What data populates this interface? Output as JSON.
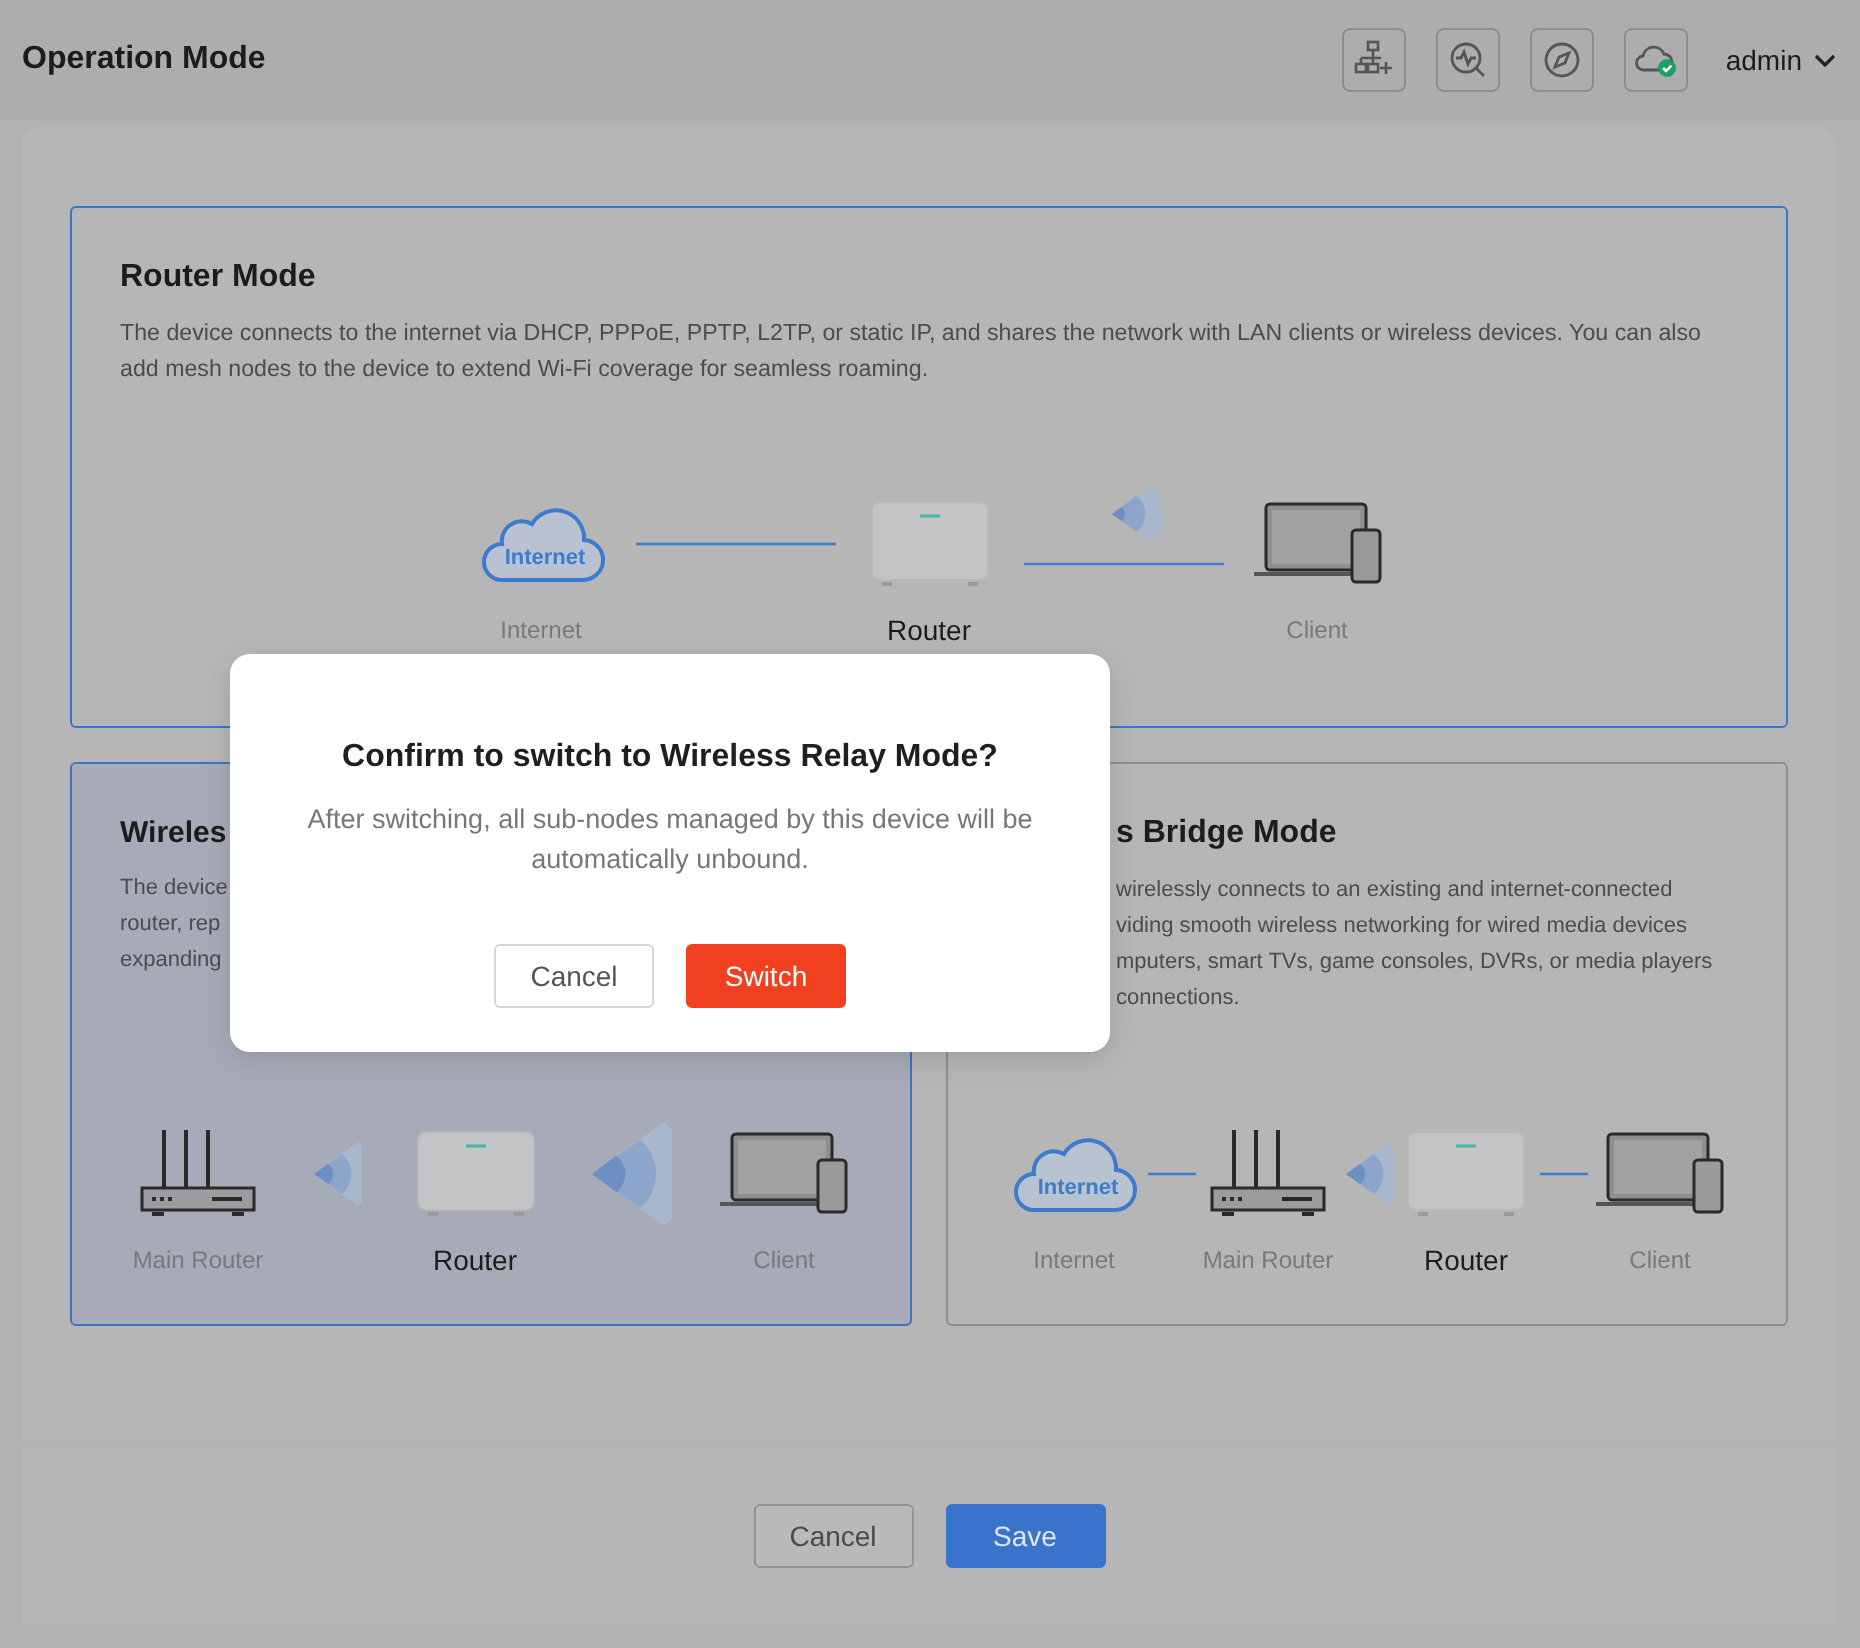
{
  "header": {
    "title": "Operation Mode",
    "user": "admin"
  },
  "cards": [
    {
      "title": "Router Mode",
      "current": true,
      "selected": false,
      "description": "The device connects to the internet via DHCP, PPPoE, PPTP, L2TP, or static IP, and shares the network with LAN clients or wireless devices. You can also add mesh nodes to the device to extend Wi-Fi coverage for seamless roaming.",
      "diagram": [
        {
          "kind": "cloud",
          "text": "Internet",
          "label": "Internet",
          "primary": false
        },
        {
          "kind": "line"
        },
        {
          "kind": "router",
          "label": "Router",
          "primary": true
        },
        {
          "kind": "wifi-line"
        },
        {
          "kind": "client",
          "label": "Client",
          "primary": false
        }
      ]
    },
    {
      "title": "Wireles",
      "current": false,
      "selected": true,
      "lines": [
        "The device",
        "router, rep",
        "expanding"
      ],
      "diagram": [
        {
          "kind": "main-router",
          "label": "Main Router",
          "primary": false
        },
        {
          "kind": "wifi"
        },
        {
          "kind": "router",
          "label": "Router",
          "primary": true
        },
        {
          "kind": "wifi-large"
        },
        {
          "kind": "client",
          "label": "Client",
          "primary": false
        }
      ]
    },
    {
      "title": "s Bridge Mode",
      "current": false,
      "selected": false,
      "lines": [
        "wirelessly connects to an existing and internet-connected",
        "viding smooth wireless networking for wired media devices",
        "mputers, smart TVs, game consoles, DVRs, or media players",
        "connections."
      ],
      "diagram": [
        {
          "kind": "cloud",
          "text": "Internet",
          "label": "Internet",
          "primary": false
        },
        {
          "kind": "short-line"
        },
        {
          "kind": "main-router",
          "label": "Main Router",
          "primary": false
        },
        {
          "kind": "wifi"
        },
        {
          "kind": "router",
          "label": "Router",
          "primary": true
        },
        {
          "kind": "short-line"
        },
        {
          "kind": "client",
          "label": "Client",
          "primary": false
        }
      ]
    }
  ],
  "footer": {
    "buttons": [
      {
        "label": "Cancel",
        "kind": "secondary"
      },
      {
        "label": "Save",
        "kind": "primary"
      }
    ]
  },
  "dialog": {
    "title": "Confirm to switch to Wireless Relay Mode?",
    "message": "After switching, all sub-nodes managed by this device will be automatically unbound.",
    "buttons": [
      {
        "label": "Cancel",
        "kind": "secondary"
      },
      {
        "label": "Switch",
        "kind": "danger"
      }
    ]
  }
}
